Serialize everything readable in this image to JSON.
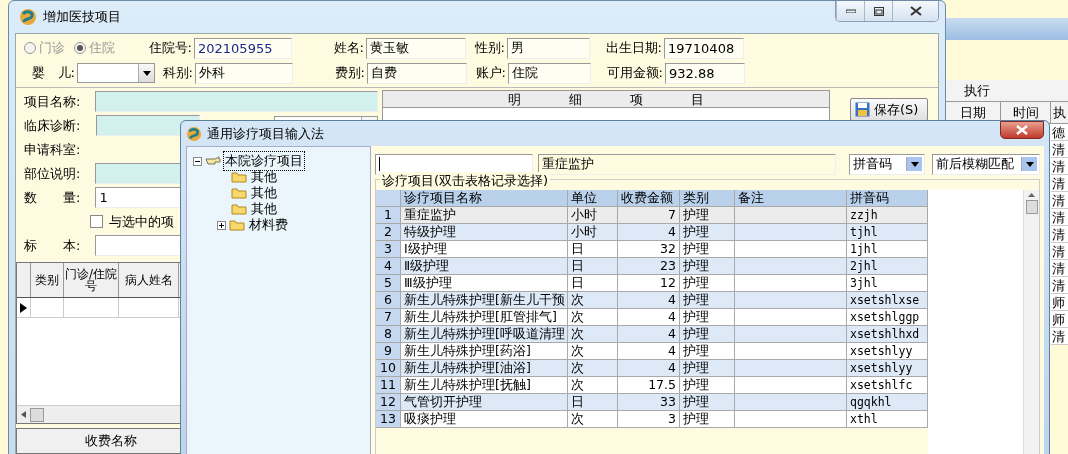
{
  "main_window": {
    "title": "增加医技项目",
    "visit_type": [
      {
        "label": "门诊",
        "selected": false,
        "disabled": true
      },
      {
        "label": "住院",
        "selected": true,
        "disabled": true
      }
    ],
    "info_row_1": [
      {
        "label": "住院号:",
        "value": "202105955"
      },
      {
        "label": "姓名:",
        "value": "黄玉敏"
      },
      {
        "label": "性别:",
        "value": "男"
      },
      {
        "label": "出生日期:",
        "value": "19710408"
      }
    ],
    "info_row_2": [
      {
        "label": "婴　儿:",
        "kind": "dropdown"
      },
      {
        "label": "科别:",
        "value": "外科",
        "kind": "text"
      },
      {
        "label": "费别:",
        "value": "自费",
        "kind": "text"
      },
      {
        "label": "账户:",
        "value": "住院",
        "kind": "text"
      },
      {
        "label": "可用金额:",
        "value": "932.88",
        "kind": "text"
      }
    ],
    "form": [
      {
        "label": "项目名称:",
        "kind": "lookup"
      },
      {
        "label": "临床诊断:",
        "kind": "combo"
      },
      {
        "label": "申请科室:",
        "kind": "label"
      },
      {
        "label": "部位说明:",
        "kind": "lookup"
      },
      {
        "label": "数　　量:",
        "kind": "entry",
        "value": "1"
      },
      {
        "label": "与选中的项",
        "kind": "checkbox",
        "checked": false
      },
      {
        "label": "标　　本:",
        "kind": "entry"
      }
    ],
    "grid": {
      "columns": [
        "类别",
        "门诊/住院号",
        "病人姓名"
      ],
      "rows": [
        {
          "current": true
        }
      ]
    },
    "fee_grid": {
      "columns": [
        "收费名称"
      ]
    },
    "detail_header": "明 细 项 目",
    "save_button": "保存(S)"
  },
  "execution_grid": {
    "group": "执行",
    "columns": [
      "日期",
      "时间",
      "执"
    ],
    "cells": [
      "德",
      "清",
      "清",
      "清",
      "清",
      "清",
      "清",
      "清",
      "清",
      "清",
      "师",
      "师",
      "清"
    ]
  },
  "dialog": {
    "title": "通用诊疗项目输入法",
    "tree": [
      {
        "label": "本院诊疗项目",
        "expanded": true,
        "selected": true,
        "children": [
          {
            "label": "其他",
            "selected": false
          },
          {
            "label": "其他",
            "selected": false
          },
          {
            "label": "其他",
            "selected": false
          },
          {
            "label": "材料费",
            "selected": false,
            "expanded": false
          }
        ]
      }
    ],
    "search_value": "重症监护",
    "code_type": "拼音码",
    "match_mode": "前后模糊匹配",
    "group_title": "诊疗项目(双击表格记录选择)",
    "columns": [
      "诊疗项目名称",
      "单位",
      "收费金额",
      "类别",
      "备注",
      "拼音码"
    ],
    "rows": [
      {
        "no": "1",
        "name": "重症监护",
        "unit": "小时",
        "amount": "7",
        "category": "护理",
        "pinyin": "zzjh",
        "selected": true
      },
      {
        "no": "2",
        "name": "特级护理",
        "unit": "小时",
        "amount": "4",
        "category": "护理",
        "pinyin": "tjhl",
        "selected": false
      },
      {
        "no": "3",
        "name": "Ⅰ级护理",
        "unit": "日",
        "amount": "32",
        "category": "护理",
        "pinyin": "1jhl",
        "selected": false
      },
      {
        "no": "4",
        "name": "Ⅱ级护理",
        "unit": "日",
        "amount": "23",
        "category": "护理",
        "pinyin": "2jhl",
        "selected": false
      },
      {
        "no": "5",
        "name": "Ⅲ级护理",
        "unit": "日",
        "amount": "12",
        "category": "护理",
        "pinyin": "3jhl",
        "selected": false
      },
      {
        "no": "6",
        "name": "新生儿特殊护理[新生儿干预",
        "unit": "次",
        "amount": "4",
        "category": "护理",
        "pinyin": "xsetshlxse",
        "selected": false
      },
      {
        "no": "7",
        "name": "新生儿特殊护理[肛管排气]",
        "unit": "次",
        "amount": "4",
        "category": "护理",
        "pinyin": "xsetshlggp",
        "selected": false
      },
      {
        "no": "8",
        "name": "新生儿特殊护理[呼吸道清理",
        "unit": "次",
        "amount": "4",
        "category": "护理",
        "pinyin": "xsetshlhxd",
        "selected": false
      },
      {
        "no": "9",
        "name": "新生儿特殊护理[药浴]",
        "unit": "次",
        "amount": "4",
        "category": "护理",
        "pinyin": "xsetshlyy",
        "selected": false
      },
      {
        "no": "10",
        "name": "新生儿特殊护理[油浴]",
        "unit": "次",
        "amount": "4",
        "category": "护理",
        "pinyin": "xsetshlyy",
        "selected": false
      },
      {
        "no": "11",
        "name": "新生儿特殊护理[抚触]",
        "unit": "次",
        "amount": "17.5",
        "category": "护理",
        "pinyin": "xsetshlfc",
        "selected": false
      },
      {
        "no": "12",
        "name": "气管切开护理",
        "unit": "日",
        "amount": "33",
        "category": "护理",
        "pinyin": "qgqkhl",
        "selected": false
      },
      {
        "no": "13",
        "name": "吸痰护理",
        "unit": "次",
        "amount": "3",
        "category": "护理",
        "pinyin": "xthl",
        "selected": false
      }
    ]
  }
}
